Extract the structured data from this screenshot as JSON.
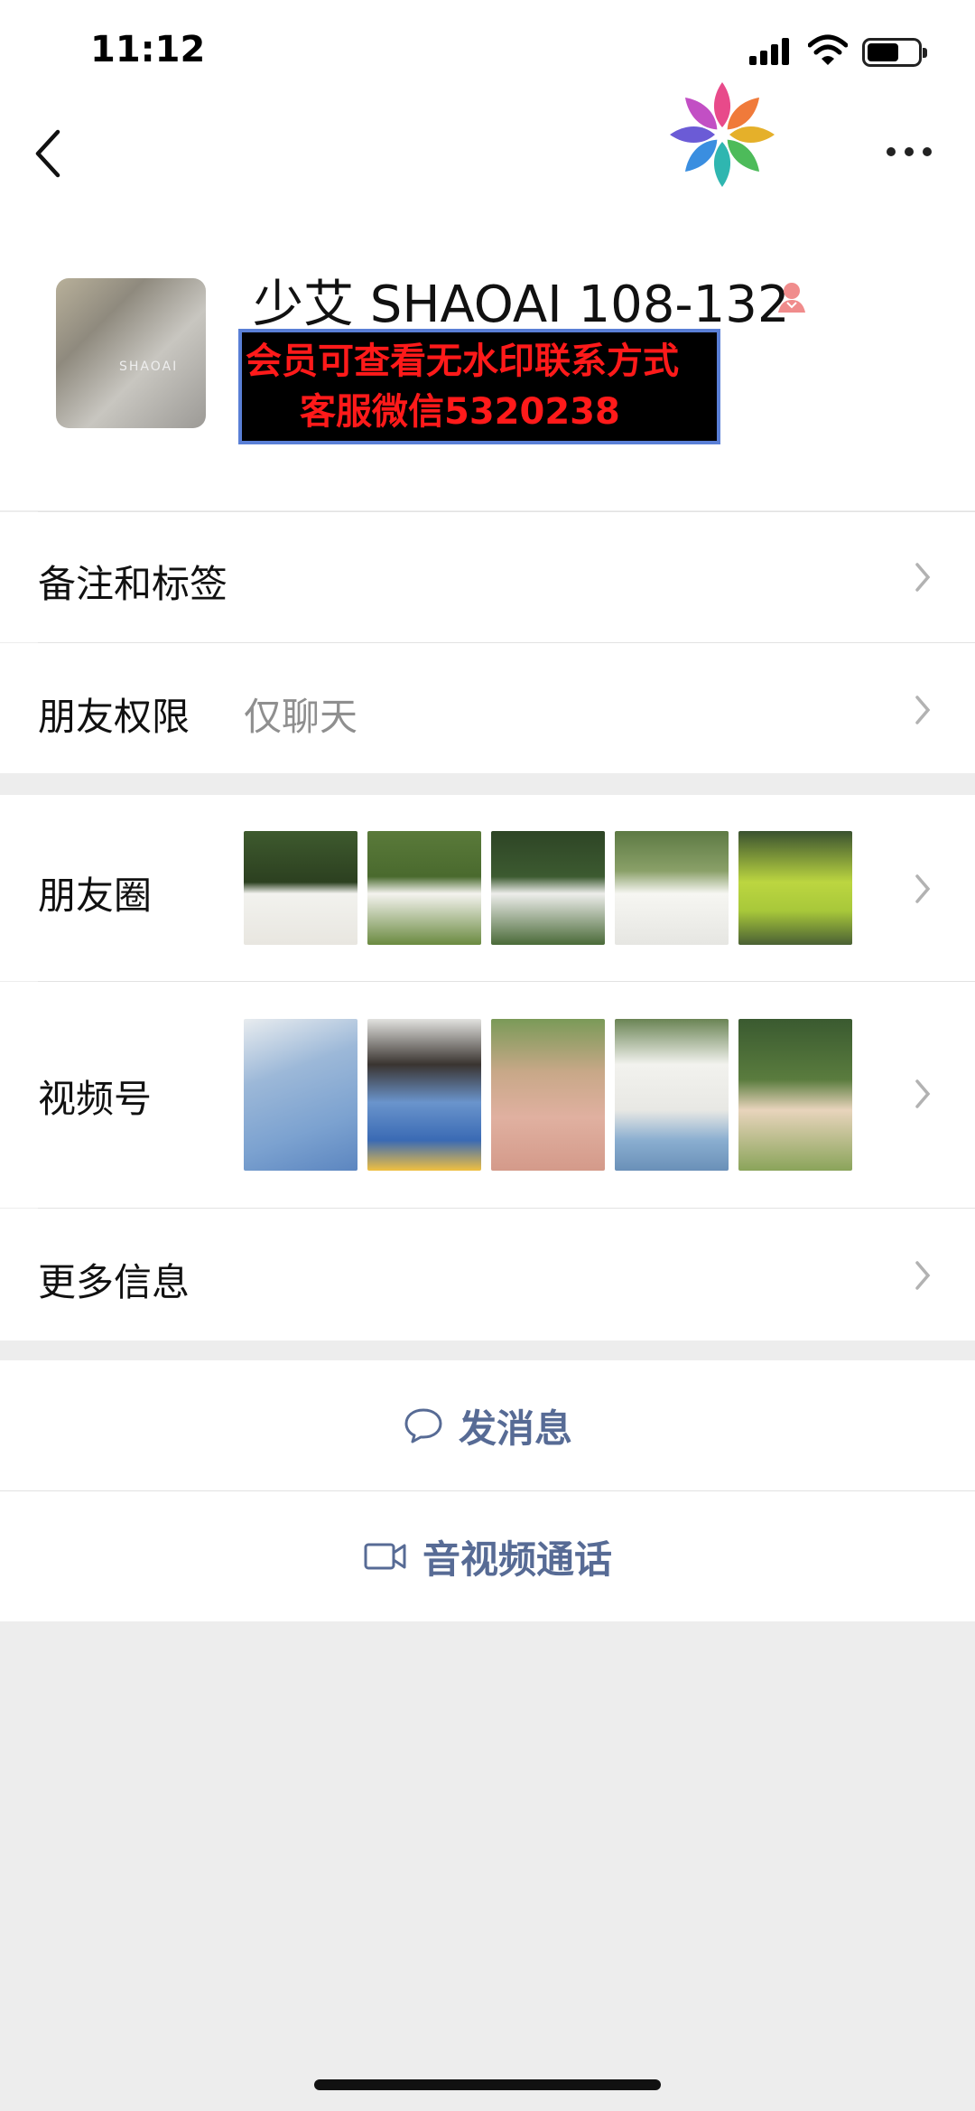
{
  "status_bar": {
    "time": "11:12"
  },
  "profile": {
    "name": "少艾 SHAOAI 108-132",
    "avatar_text": "SHAOAI",
    "banner_line1": "会员可查看无水印联系方式",
    "banner_line2": "客服微信5320238"
  },
  "rows": {
    "notes_label": "备注和标签",
    "permissions_label": "朋友权限",
    "permissions_value": "仅聊天",
    "moments_label": "朋友圈",
    "channels_label": "视频号",
    "more_info_label": "更多信息"
  },
  "actions": {
    "message_label": "发消息",
    "call_label": "音视频通话"
  },
  "colors": {
    "accent": "#576b95",
    "banner_text": "#ff1a1a",
    "banner_border": "#5a7fd6",
    "background": "#ededed"
  },
  "icons": [
    "back-icon",
    "logo-flower-icon",
    "more-icon",
    "gender-female-icon",
    "chevron-right-icon",
    "chat-bubble-icon",
    "video-camera-icon"
  ]
}
